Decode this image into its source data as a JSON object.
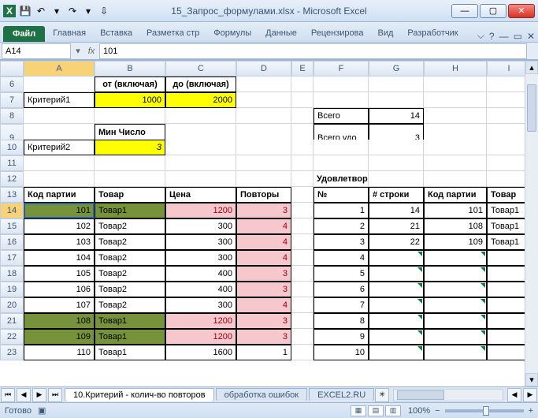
{
  "window": {
    "title": "15_Запрос_формулами.xlsx - Microsoft Excel"
  },
  "qat": {
    "excel": "X",
    "save": "💾",
    "undo": "↶",
    "redo": "↷",
    "dd": "▾"
  },
  "ribbon": {
    "file": "Файл",
    "tabs": [
      "Главная",
      "Вставка",
      "Разметка стр",
      "Формулы",
      "Данные",
      "Рецензирова",
      "Вид",
      "Разработчик"
    ]
  },
  "formula": {
    "namebox": "A14",
    "fx": "fx",
    "value": "101"
  },
  "columns": [
    "A",
    "B",
    "C",
    "D",
    "E",
    "F",
    "G",
    "H",
    "I"
  ],
  "rows": [
    "6",
    "7",
    "8",
    "9",
    "10",
    "11",
    "12",
    "13",
    "14",
    "15",
    "16",
    "17",
    "18",
    "19",
    "20",
    "21",
    "22",
    "23"
  ],
  "cells": {
    "b6": "от (включая)",
    "c6": "до (включая)",
    "a7": "Критерий1",
    "b7": "1000",
    "c7": "2000",
    "b9": "Мин Число повторов",
    "a10": "Критерий2",
    "b10": "3",
    "f8": "Всего",
    "g8": "14",
    "f9": "Всего удо",
    "g9": "3",
    "f12": "Удовлетворяют критериям",
    "a13": "Код партии",
    "b13": "Товар",
    "c13": "Цена",
    "d13": "Повторы",
    "f13": "№",
    "g13": "# строки",
    "h13": "Код партии",
    "i13": "Товар",
    "a14": "101",
    "b14": "Товар1",
    "c14": "1200",
    "d14": "3",
    "f14": "1",
    "g14": "14",
    "h14": "101",
    "i14": "Товар1",
    "a15": "102",
    "b15": "Товар2",
    "c15": "300",
    "d15": "4",
    "f15": "2",
    "g15": "21",
    "h15": "108",
    "i15": "Товар1",
    "a16": "103",
    "b16": "Товар2",
    "c16": "300",
    "d16": "4",
    "f16": "3",
    "g16": "22",
    "h16": "109",
    "i16": "Товар1",
    "a17": "104",
    "b17": "Товар2",
    "c17": "300",
    "d17": "4",
    "f17": "4",
    "a18": "105",
    "b18": "Товар2",
    "c18": "400",
    "d18": "3",
    "f18": "5",
    "a19": "106",
    "b19": "Товар2",
    "c19": "400",
    "d19": "3",
    "f19": "6",
    "a20": "107",
    "b20": "Товар2",
    "c20": "300",
    "d20": "4",
    "f20": "7",
    "a21": "108",
    "b21": "Товар1",
    "c21": "1200",
    "d21": "3",
    "f21": "8",
    "a22": "109",
    "b22": "Товар1",
    "c22": "1200",
    "d22": "3",
    "f22": "9",
    "a23": "110",
    "b23": "Товар1",
    "c23": "1600",
    "d23": "1",
    "f23": "10"
  },
  "sheets": {
    "nav": [
      "⏮",
      "◀",
      "▶",
      "⏭"
    ],
    "active": "10.Критерий - колич-во повторов",
    "others": [
      "обработка ошибок",
      "EXCEL2.RU"
    ]
  },
  "status": {
    "ready": "Готово",
    "zoom": "100%",
    "minus": "−",
    "plus": "+"
  }
}
